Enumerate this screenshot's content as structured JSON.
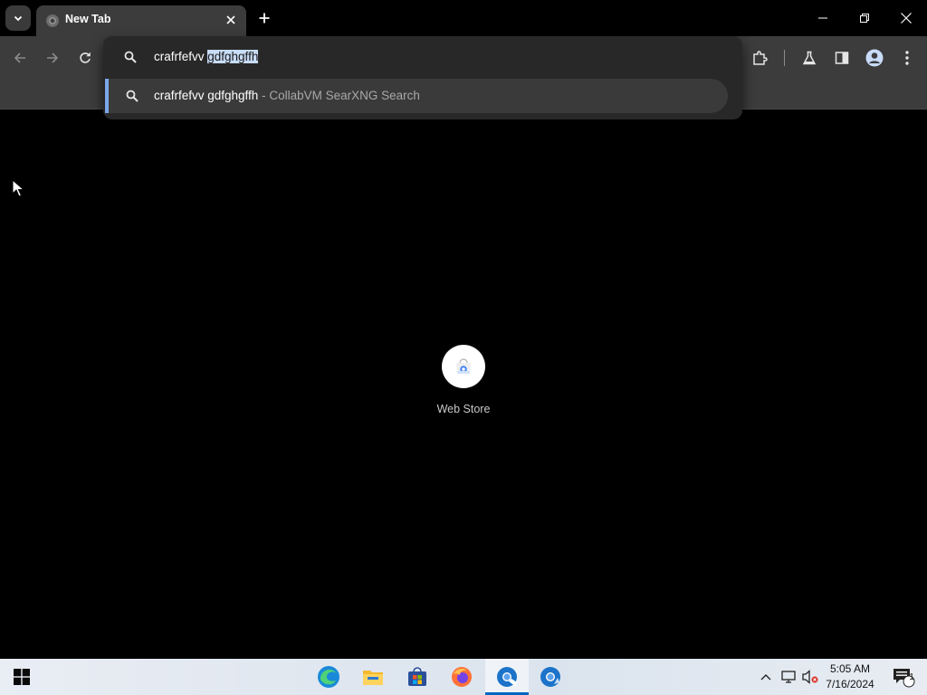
{
  "browser": {
    "tab": {
      "title": "New Tab"
    },
    "omnibox": {
      "typed_prefix": "crafrfefvv ",
      "selected_completion": "gdfghgffh",
      "suggestion": {
        "query": "crafrfefvv gdfghgffh",
        "separator": " - ",
        "engine": "CollabVM SearXNG Search"
      }
    }
  },
  "new_tab_page": {
    "shortcuts": [
      {
        "label": "Web Store",
        "icon": "chrome-web-store-icon"
      }
    ]
  },
  "taskbar": {
    "apps": [
      "edge-icon",
      "file-explorer-icon",
      "microsoft-store-icon",
      "firefox-icon",
      "chrome-icon",
      "chrome-beta-icon"
    ],
    "clock": {
      "time": "5:05 AM",
      "date": "7/16/2024"
    },
    "notification_count": "1"
  },
  "colors": {
    "toolbar": "#3c3c3c",
    "accent": "#7aa7e8",
    "taskbar_accent": "#0067c0"
  }
}
